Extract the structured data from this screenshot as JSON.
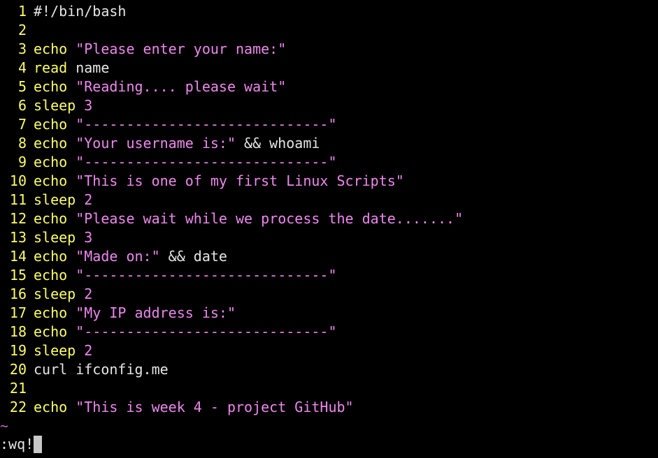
{
  "lines": [
    {
      "num": "1",
      "tokens": [
        {
          "t": "#!/bin/bash",
          "k": "comment"
        }
      ]
    },
    {
      "num": "2",
      "tokens": []
    },
    {
      "num": "3",
      "tokens": [
        {
          "t": "echo",
          "k": "builtin"
        },
        {
          "t": " ",
          "k": "plain"
        },
        {
          "t": "\"Please enter your name:\"",
          "k": "string"
        }
      ]
    },
    {
      "num": "4",
      "tokens": [
        {
          "t": "read",
          "k": "builtin"
        },
        {
          "t": " name",
          "k": "plain"
        }
      ]
    },
    {
      "num": "5",
      "tokens": [
        {
          "t": "echo",
          "k": "builtin"
        },
        {
          "t": " ",
          "k": "plain"
        },
        {
          "t": "\"Reading.... please wait\"",
          "k": "string"
        }
      ]
    },
    {
      "num": "6",
      "tokens": [
        {
          "t": "sleep",
          "k": "builtin"
        },
        {
          "t": " ",
          "k": "plain"
        },
        {
          "t": "3",
          "k": "number"
        }
      ]
    },
    {
      "num": "7",
      "tokens": [
        {
          "t": "echo",
          "k": "builtin"
        },
        {
          "t": " ",
          "k": "plain"
        },
        {
          "t": "\"-----------------------------\"",
          "k": "string"
        }
      ]
    },
    {
      "num": "8",
      "tokens": [
        {
          "t": "echo",
          "k": "builtin"
        },
        {
          "t": " ",
          "k": "plain"
        },
        {
          "t": "\"Your username is:\"",
          "k": "string"
        },
        {
          "t": " && whoami",
          "k": "plain"
        }
      ]
    },
    {
      "num": "9",
      "tokens": [
        {
          "t": "echo",
          "k": "builtin"
        },
        {
          "t": " ",
          "k": "plain"
        },
        {
          "t": "\"-----------------------------\"",
          "k": "string"
        }
      ]
    },
    {
      "num": "10",
      "tokens": [
        {
          "t": "echo",
          "k": "builtin"
        },
        {
          "t": " ",
          "k": "plain"
        },
        {
          "t": "\"This is one of my first Linux Scripts\"",
          "k": "string"
        }
      ]
    },
    {
      "num": "11",
      "tokens": [
        {
          "t": "sleep",
          "k": "builtin"
        },
        {
          "t": " ",
          "k": "plain"
        },
        {
          "t": "2",
          "k": "number"
        }
      ]
    },
    {
      "num": "12",
      "tokens": [
        {
          "t": "echo",
          "k": "builtin"
        },
        {
          "t": " ",
          "k": "plain"
        },
        {
          "t": "\"Please wait while we process the date.......\"",
          "k": "string"
        }
      ]
    },
    {
      "num": "13",
      "tokens": [
        {
          "t": "sleep",
          "k": "builtin"
        },
        {
          "t": " ",
          "k": "plain"
        },
        {
          "t": "3",
          "k": "number"
        }
      ]
    },
    {
      "num": "14",
      "tokens": [
        {
          "t": "echo",
          "k": "builtin"
        },
        {
          "t": " ",
          "k": "plain"
        },
        {
          "t": "\"Made on:\"",
          "k": "string"
        },
        {
          "t": " && date",
          "k": "plain"
        }
      ]
    },
    {
      "num": "15",
      "tokens": [
        {
          "t": "echo",
          "k": "builtin"
        },
        {
          "t": " ",
          "k": "plain"
        },
        {
          "t": "\"-----------------------------\"",
          "k": "string"
        }
      ]
    },
    {
      "num": "16",
      "tokens": [
        {
          "t": "sleep",
          "k": "builtin"
        },
        {
          "t": " ",
          "k": "plain"
        },
        {
          "t": "2",
          "k": "number"
        }
      ]
    },
    {
      "num": "17",
      "tokens": [
        {
          "t": "echo",
          "k": "builtin"
        },
        {
          "t": " ",
          "k": "plain"
        },
        {
          "t": "\"My IP address is:\"",
          "k": "string"
        }
      ]
    },
    {
      "num": "18",
      "tokens": [
        {
          "t": "echo",
          "k": "builtin"
        },
        {
          "t": " ",
          "k": "plain"
        },
        {
          "t": "\"-----------------------------\"",
          "k": "string"
        }
      ]
    },
    {
      "num": "19",
      "tokens": [
        {
          "t": "sleep",
          "k": "builtin"
        },
        {
          "t": " ",
          "k": "plain"
        },
        {
          "t": "2",
          "k": "number"
        }
      ]
    },
    {
      "num": "20",
      "tokens": [
        {
          "t": "curl ifconfig.me",
          "k": "plain"
        }
      ]
    },
    {
      "num": "21",
      "tokens": []
    },
    {
      "num": "22",
      "tokens": [
        {
          "t": "echo",
          "k": "builtin"
        },
        {
          "t": " ",
          "k": "plain"
        },
        {
          "t": "\"This is week 4 - project GitHub\"",
          "k": "string"
        }
      ]
    }
  ],
  "empty_line_marker": "~",
  "command_line": ":wq!",
  "colors": {
    "background": "#000000",
    "line_number": "#ffff66",
    "builtin": "#ffff66",
    "string": "#ee88ee",
    "plain": "#e6e6e6",
    "tilde": "#c060c0",
    "cursor": "#c8c8c8"
  }
}
